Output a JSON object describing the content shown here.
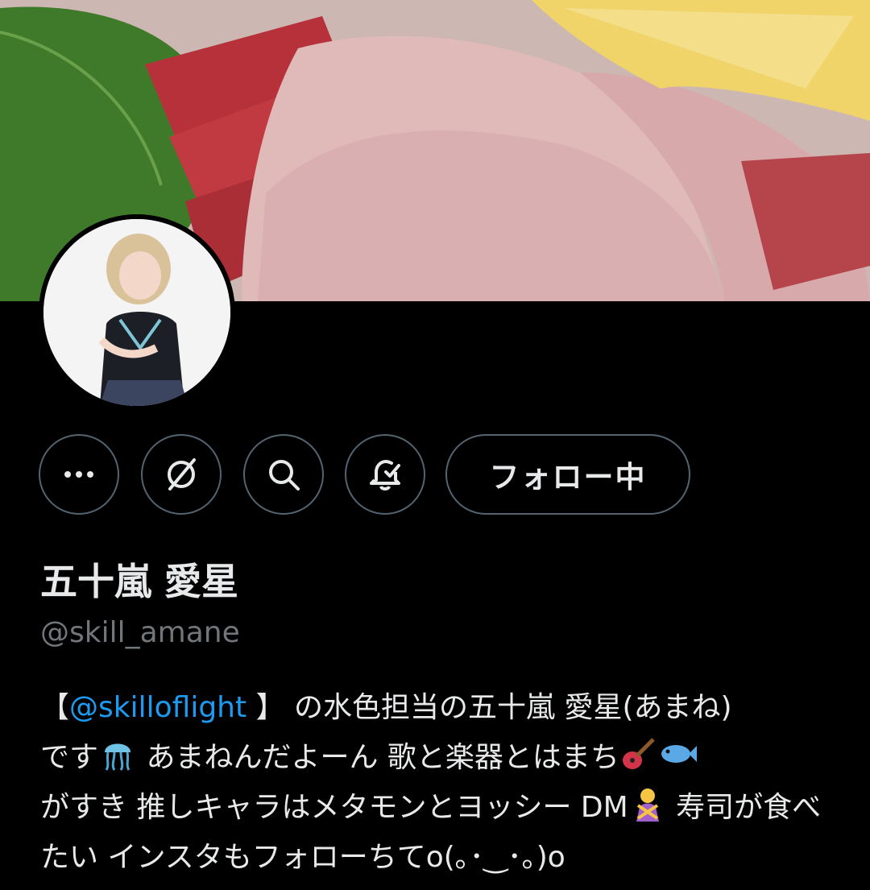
{
  "profile": {
    "display_name": "五十嵐 愛星",
    "handle": "@skill_amane"
  },
  "actions": {
    "more": "more-icon",
    "grok": "grok-icon",
    "search": "search-icon",
    "notify": "notification-bell-icon",
    "follow_label": "フォロー中"
  },
  "bio": {
    "open_bracket": "【",
    "mention": "@skilloflight",
    "close_bracket": " 】",
    "line1_rest": " の水色担当の五十嵐 愛星(あまね)",
    "t2": "です",
    "t3": " あまねんだよーん 歌と楽器とはまち",
    "t4": "がすき 推しキャラはメタモンとヨッシー DM",
    "t5": " 寿司が食べたい インスタもフォローちてo(｡･‿･｡)o",
    "emoji_jellyfish": "jellyfish-emoji",
    "emoji_guitar": "guitar-emoji",
    "emoji_fish": "fish-emoji",
    "emoji_no_gesture": "person-gesturing-no-emoji"
  },
  "colors": {
    "background": "#000000",
    "text": "#e7e9ea",
    "secondary": "#71767b",
    "border": "#536471",
    "link": "#1d9bf0"
  }
}
